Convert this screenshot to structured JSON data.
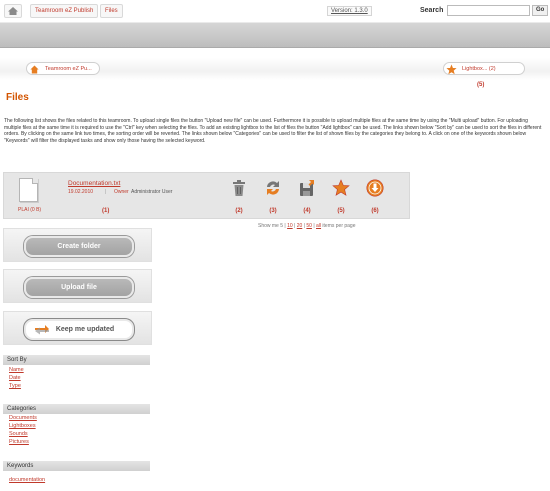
{
  "topbar": {
    "breadcrumbs": [
      "Teamroom eZ Publish",
      "Files"
    ],
    "version": "Version: 1.3.0",
    "search_label": "Search",
    "search_value": "",
    "go_label": "Go"
  },
  "nav": {
    "home_pill": "Teamroom eZ Pu...",
    "lightbox_pill": "Lightbox... (2)",
    "lightbox_number": "(5)"
  },
  "page": {
    "title": "Files",
    "description": "The following list shows the files related to this teamroom. To upload single files the button \"Upload new file\" can be used. Furthermore it is possible to upload multiple files at the same time by using the \"Multi upload\" button. For uploading multiple files at the same time it is required to use the \"Ctrl\" key when selecting the files. To add an existing lightbox to the list of files the button \"Add lightbox\" can be used. The links shown below \"Sort by\" can be used to sort the files in different orders. By clicking on the same link two times, the sorting order will be reverted. The links shown below \"Categories\" can be used to filter the list of shown files by the categories they belong to. A click on one of the keywords shown below \"Keywords\" will filter the displayed tasks and show only those having the selected keyword."
  },
  "file": {
    "type_label": "PLAI (0 B)",
    "name": "Documentation.txt",
    "date": "19.02.2010",
    "owner_label": "Owner",
    "owner": "Administrator User",
    "number": "(1)",
    "actions": [
      {
        "icon": "trash-icon",
        "number": "(2)"
      },
      {
        "icon": "refresh-icon",
        "number": "(3)"
      },
      {
        "icon": "save-icon",
        "number": "(4)"
      },
      {
        "icon": "star-icon",
        "number": "(5)"
      },
      {
        "icon": "download-icon",
        "number": "(6)"
      }
    ]
  },
  "paging": {
    "prefix": "Show me 5",
    "options": [
      "10",
      "20",
      "50",
      "all"
    ],
    "suffix": "items per page"
  },
  "sidebar": {
    "create_folder": "Create folder",
    "upload_file": "Upload file",
    "keep_updated": "Keep me updated"
  },
  "sort_by": {
    "title": "Sort By",
    "items": [
      "Name",
      "Date",
      "Type"
    ]
  },
  "categories": {
    "title": "Categories",
    "items": [
      "Documents",
      "Lightboxes",
      "Sounds",
      "Pictures"
    ]
  },
  "keywords": {
    "title": "Keywords",
    "items": [
      "documentation"
    ]
  },
  "colors": {
    "accent": "#c0392b",
    "title": "#d35400",
    "star": "#e67e22"
  }
}
